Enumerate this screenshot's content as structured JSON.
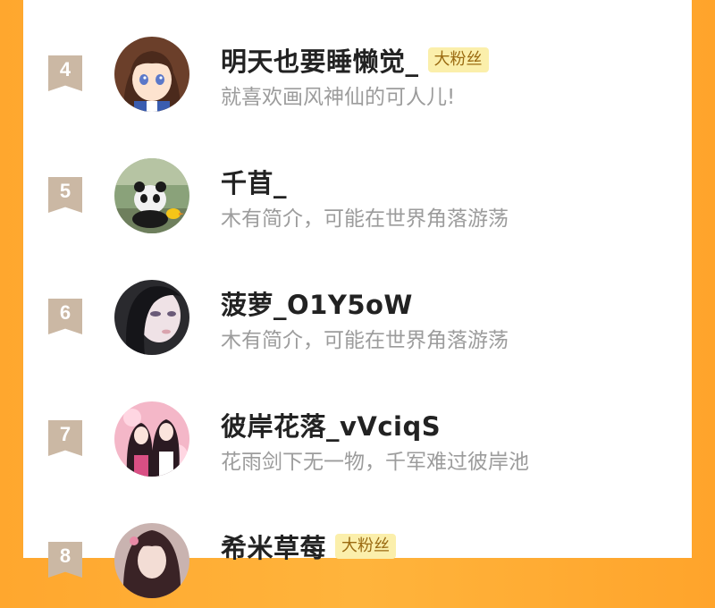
{
  "leaderboard": {
    "entries": [
      {
        "rank": "4",
        "name": "明天也要睡懒觉_",
        "badge": "大粉丝",
        "bio": "就喜欢画风神仙的可人儿!",
        "avatar": "anime-girl-avatar"
      },
      {
        "rank": "5",
        "name": "千苜_",
        "badge": "",
        "bio": "木有简介，可能在世界角落游荡",
        "avatar": "panda-avatar"
      },
      {
        "rank": "6",
        "name": "菠萝_O1Y5oW",
        "badge": "",
        "bio": "木有简介，可能在世界角落游荡",
        "avatar": "selfie-girl-avatar"
      },
      {
        "rank": "7",
        "name": "彼岸花落_vVciqS",
        "badge": "",
        "bio": "花雨剑下无一物，千军难过彼岸池",
        "avatar": "two-girls-avatar"
      },
      {
        "rank": "8",
        "name": "希米草莓",
        "badge": "大粉丝",
        "bio": "",
        "avatar": "dark-hair-girl-avatar"
      }
    ]
  },
  "colors": {
    "background_orange": "#ffab33",
    "rank_ribbon": "#cbb8a4",
    "badge_bg": "#fbefab",
    "badge_text": "#9b6b12",
    "name_text": "#222222",
    "bio_text": "#9c9c9c"
  }
}
